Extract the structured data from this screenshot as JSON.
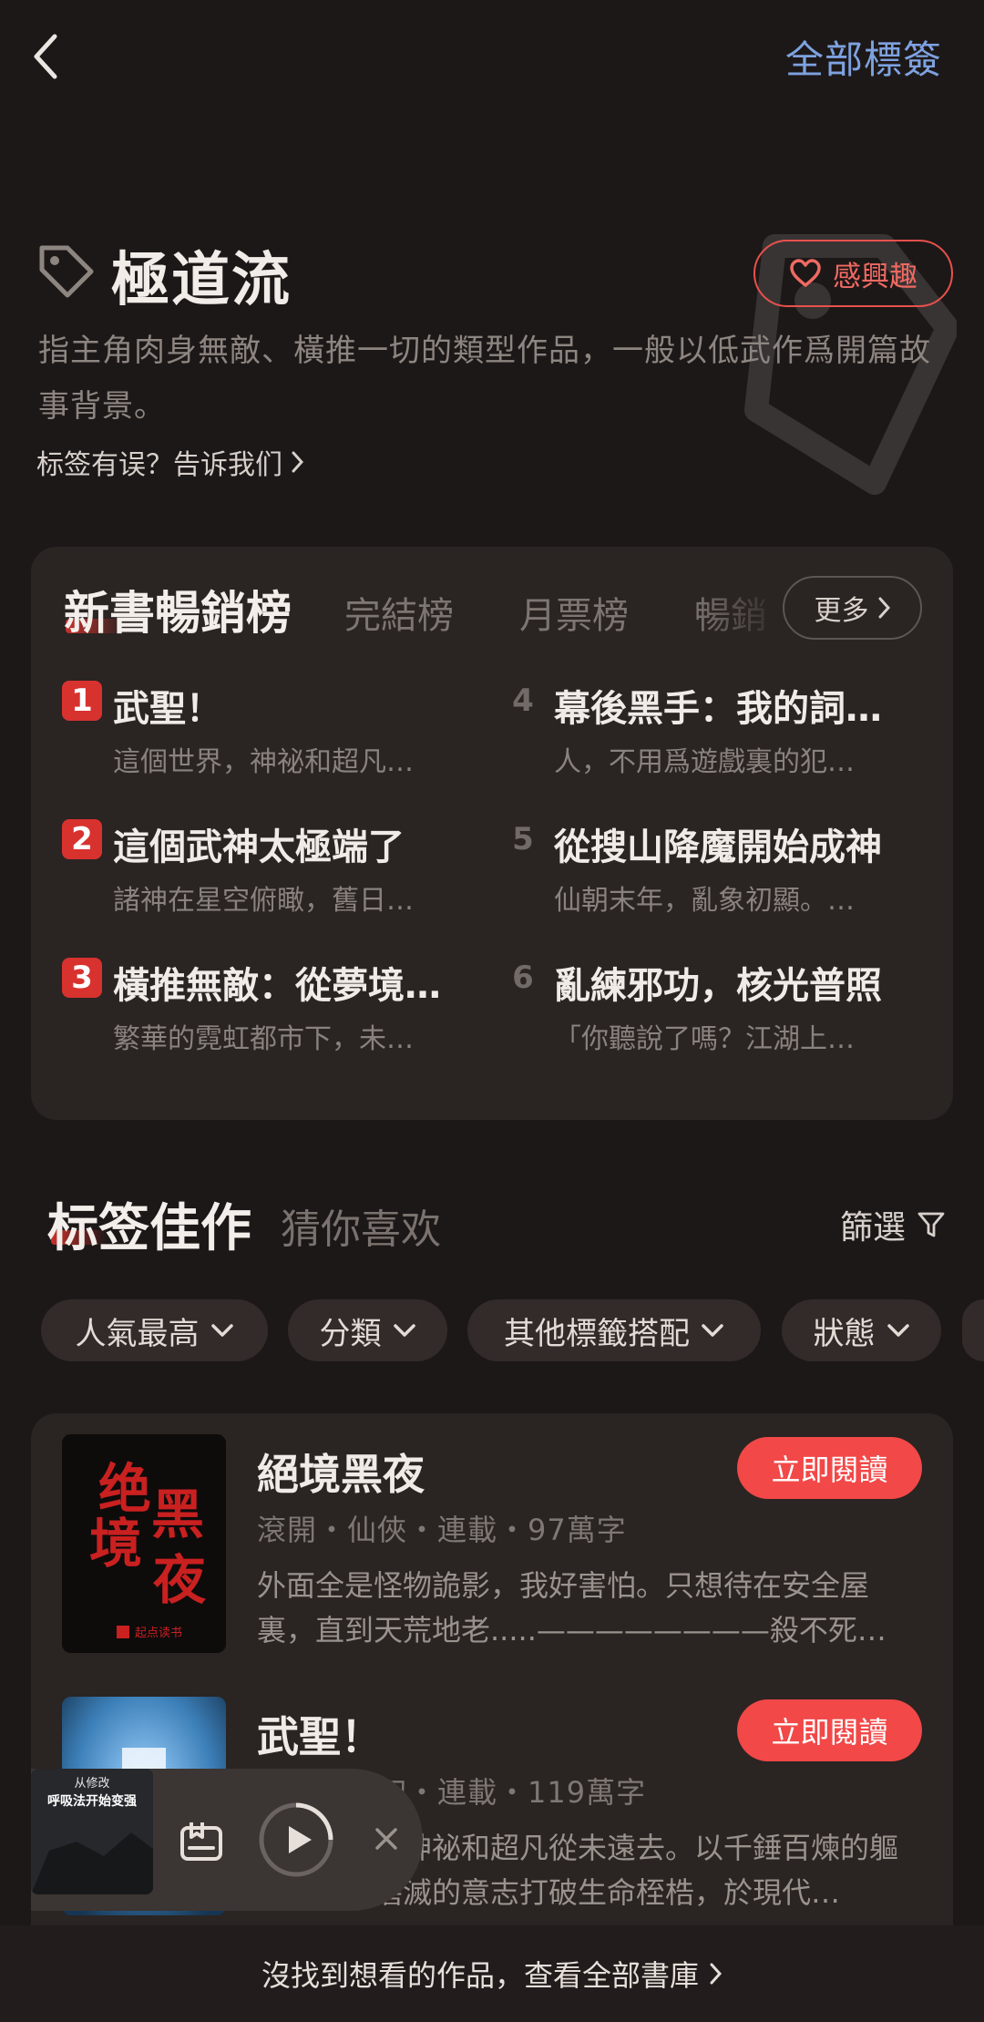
{
  "header": {
    "all_tags_label": "全部標簽"
  },
  "tag": {
    "title": "極道流",
    "interest_label": "感興趣",
    "description": "指主角肉身無敵、橫推一切的類型作品，一般以低武作爲開篇故事背景。",
    "report_label": "标签有误？告诉我们"
  },
  "ranking": {
    "tabs": [
      "新書暢銷榜",
      "完結榜",
      "月票榜",
      "暢銷"
    ],
    "more_label": "更多",
    "items": [
      {
        "rank": "1",
        "title": "武聖！",
        "desc": "這個世界，神祕和超凡…"
      },
      {
        "rank": "2",
        "title": "這個武神太極端了",
        "desc": "諸神在星空俯瞰，舊日…"
      },
      {
        "rank": "3",
        "title": "橫推無敵：從夢境…",
        "desc": "繁華的霓虹都市下，未…"
      },
      {
        "rank": "4",
        "title": "幕後黑手：我的詞…",
        "desc": "人，不用爲遊戲裏的犯…"
      },
      {
        "rank": "5",
        "title": "從搜山降魔開始成神",
        "desc": "仙朝末年，亂象初顯。…"
      },
      {
        "rank": "6",
        "title": "亂練邪功，核光普照",
        "desc": "「你聽說了嗎？江湖上…"
      }
    ]
  },
  "section": {
    "title": "标签佳作",
    "alt_title": "猜你喜欢",
    "filter_label": "篩選",
    "chips": [
      "人氣最高",
      "分類",
      "其他標籤搭配",
      "狀態"
    ]
  },
  "books": [
    {
      "title": "絕境黑夜",
      "meta": "滾開・仙俠・連載・97萬字",
      "desc": "外面全是怪物詭影，我好害怕。只想待在安全屋裏，直到天荒地老.....————————殺不死…",
      "read_label": "立即閱讀",
      "cover_text": "绝境黑夜",
      "cover_brand": "起点读书"
    },
    {
      "title": "武聖！",
      "meta": "田畔・玄幻・連載・119萬字",
      "desc": "這個世界，神祕和超凡從未遠去。以千錘百煉的軀體和永不磨滅的意志打破生命桎梏，於現代…",
      "read_label": "立即閱讀"
    }
  ],
  "mini_player": {
    "cover_line1": "从修改",
    "cover_line2": "呼吸法开始变强"
  },
  "footer": {
    "library_link": "沒找到想看的作品，查看全部書庫"
  },
  "colors": {
    "accent_red": "#f24848",
    "link_blue": "#7ea2e0",
    "bg": "#1d1818",
    "card": "#2a2422"
  }
}
